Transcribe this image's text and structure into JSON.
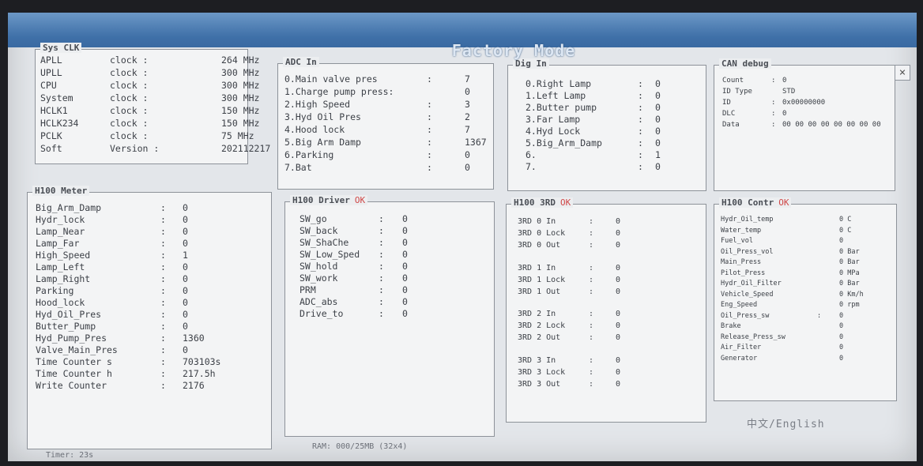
{
  "window": {
    "title": "Factory Mode",
    "close_glyph": "×"
  },
  "sys_clk": {
    "title": "Sys CLK",
    "rows": [
      {
        "name": "APLL",
        "sep": "clock :",
        "value": "264 MHz"
      },
      {
        "name": "UPLL",
        "sep": "clock :",
        "value": "300 MHz"
      },
      {
        "name": "CPU",
        "sep": "clock :",
        "value": "300 MHz"
      },
      {
        "name": "System",
        "sep": "clock :",
        "value": "300 MHz"
      },
      {
        "name": "HCLK1",
        "sep": "clock :",
        "value": "150 MHz"
      },
      {
        "name": "HCLK234",
        "sep": "clock :",
        "value": "150 MHz"
      },
      {
        "name": "PCLK",
        "sep": "clock :",
        "value": "75 MHz"
      },
      {
        "name": "Soft",
        "sep": "Version :",
        "value": "202112217"
      }
    ]
  },
  "adc_in": {
    "title": "ADC In",
    "rows": [
      {
        "name": "0.Main valve pres",
        "sep": ":",
        "value": "7"
      },
      {
        "name": "1.Charge pump press:",
        "sep": "",
        "value": "0"
      },
      {
        "name": "2.High Speed",
        "sep": ":",
        "value": "3"
      },
      {
        "name": "3.Hyd Oil Pres",
        "sep": ":",
        "value": "2"
      },
      {
        "name": "4.Hood lock",
        "sep": ":",
        "value": "7"
      },
      {
        "name": "5.Big Arm Damp",
        "sep": ":",
        "value": "1367"
      },
      {
        "name": "6.Parking",
        "sep": ":",
        "value": "0"
      },
      {
        "name": "7.Bat",
        "sep": ":",
        "value": "0"
      }
    ]
  },
  "dig_in": {
    "title": "Dig In",
    "rows": [
      {
        "name": "0.Right Lamp",
        "sep": ":",
        "value": "0"
      },
      {
        "name": "1.Left Lamp",
        "sep": ":",
        "value": "0"
      },
      {
        "name": "2.Butter pump",
        "sep": ":",
        "value": "0"
      },
      {
        "name": "3.Far Lamp",
        "sep": ":",
        "value": "0"
      },
      {
        "name": "4.Hyd Lock",
        "sep": ":",
        "value": "0"
      },
      {
        "name": "5.Big_Arm_Damp",
        "sep": ":",
        "value": "0"
      },
      {
        "name": "6.",
        "sep": ":",
        "value": "1"
      },
      {
        "name": "7.",
        "sep": ":",
        "value": "0"
      }
    ]
  },
  "can_debug": {
    "title": "CAN debug",
    "rows": [
      {
        "name": "Count",
        "sep": ":",
        "value": "0"
      },
      {
        "name": "ID Type",
        "sep": "",
        "value": "STD"
      },
      {
        "name": "ID",
        "sep": ":",
        "value": "0x00000000"
      },
      {
        "name": "DLC",
        "sep": ":",
        "value": "0"
      },
      {
        "name": "Data",
        "sep": ":",
        "value": "00 00 00 00 00 00 00 00"
      }
    ]
  },
  "meter": {
    "title": "H100 Meter",
    "rows": [
      {
        "name": "Big_Arm_Damp",
        "sep": ":",
        "value": "0"
      },
      {
        "name": "Hydr_lock",
        "sep": ":",
        "value": "0"
      },
      {
        "name": "Lamp_Near",
        "sep": ":",
        "value": "0"
      },
      {
        "name": "Lamp_Far",
        "sep": ":",
        "value": "0"
      },
      {
        "name": "High_Speed",
        "sep": ":",
        "value": "1"
      },
      {
        "name": "Lamp_Left",
        "sep": ":",
        "value": "0"
      },
      {
        "name": "Lamp_Right",
        "sep": ":",
        "value": "0"
      },
      {
        "name": "Parking",
        "sep": ":",
        "value": "0"
      },
      {
        "name": "Hood_lock",
        "sep": ":",
        "value": "0"
      },
      {
        "name": "Hyd_Oil_Pres",
        "sep": ":",
        "value": "0"
      },
      {
        "name": "Butter_Pump",
        "sep": ":",
        "value": "0"
      },
      {
        "name": "Hyd_Pump_Pres",
        "sep": ":",
        "value": "1360"
      },
      {
        "name": "Valve_Main_Pres",
        "sep": ":",
        "value": "0"
      },
      {
        "name": "Time Counter s",
        "sep": ":",
        "value": "703103s"
      },
      {
        "name": "Time Counter h",
        "sep": ":",
        "value": "217.5h"
      },
      {
        "name": "Write Counter",
        "sep": ":",
        "value": "2176"
      }
    ]
  },
  "driver": {
    "title": "H100 Driver",
    "mark": "OK",
    "rows": [
      {
        "name": "SW_go",
        "sep": ":",
        "value": "0"
      },
      {
        "name": "SW_back",
        "sep": ":",
        "value": "0"
      },
      {
        "name": "SW_ShaChe",
        "sep": ":",
        "value": "0"
      },
      {
        "name": "SW_Low_Sped",
        "sep": ":",
        "value": "0"
      },
      {
        "name": "SW_hold",
        "sep": ":",
        "value": "0"
      },
      {
        "name": "SW_work",
        "sep": ":",
        "value": "0"
      },
      {
        "name": "PRM",
        "sep": ":",
        "value": "0"
      },
      {
        "name": "ADC_abs",
        "sep": ":",
        "value": "0"
      },
      {
        "name": "Drive_to",
        "sep": ":",
        "value": "0"
      }
    ]
  },
  "three_rd": {
    "title": "H100 3RD",
    "mark": "OK",
    "rows": [
      {
        "name": "3RD 0 In",
        "sep": ":",
        "value": "0"
      },
      {
        "name": "3RD 0 Lock",
        "sep": ":",
        "value": "0"
      },
      {
        "name": "3RD 0 Out",
        "sep": ":",
        "value": "0"
      },
      {
        "name": "3RD 1 In",
        "sep": ":",
        "value": "0"
      },
      {
        "name": "3RD 1 Lock",
        "sep": ":",
        "value": "0"
      },
      {
        "name": "3RD 1 Out",
        "sep": ":",
        "value": "0"
      },
      {
        "name": "3RD 2 In",
        "sep": ":",
        "value": "0"
      },
      {
        "name": "3RD 2 Lock",
        "sep": ":",
        "value": "0"
      },
      {
        "name": "3RD 2 Out",
        "sep": ":",
        "value": "0"
      },
      {
        "name": "3RD 3 In",
        "sep": ":",
        "value": "0"
      },
      {
        "name": "3RD 3 Lock",
        "sep": ":",
        "value": "0"
      },
      {
        "name": "3RD 3 Out",
        "sep": ":",
        "value": "0"
      }
    ]
  },
  "contr": {
    "title": "H100 Contr",
    "mark": "OK",
    "rows": [
      {
        "name": "Hydr_Oil_temp",
        "sep": "",
        "value": "0 C"
      },
      {
        "name": "Water_temp",
        "sep": "",
        "value": "0 C"
      },
      {
        "name": "Fuel_vol",
        "sep": "",
        "value": "0"
      },
      {
        "name": "Oil_Press_vol",
        "sep": "",
        "value": "0 Bar"
      },
      {
        "name": "Main_Press",
        "sep": "",
        "value": "0 Bar"
      },
      {
        "name": "Pilot_Press",
        "sep": "",
        "value": "0 MPa"
      },
      {
        "name": "Hydr_Oil_Filter",
        "sep": "",
        "value": "0 Bar"
      },
      {
        "name": "Vehicle_Speed",
        "sep": "",
        "value": "0 Km/h"
      },
      {
        "name": "Eng_Speed",
        "sep": "",
        "value": "0 rpm"
      },
      {
        "name": "Oil_Press_sw",
        "sep": ":",
        "value": "0"
      },
      {
        "name": "Brake",
        "sep": "",
        "value": "0"
      },
      {
        "name": "Release_Press_sw",
        "sep": "",
        "value": "0"
      },
      {
        "name": "Air_Filter",
        "sep": "",
        "value": "0"
      },
      {
        "name": "Generator",
        "sep": "",
        "value": "0"
      }
    ]
  },
  "footer": {
    "timer": "Timer: 23s",
    "ram": "RAM: 000/25MB  (32x4)",
    "language": "中文/English"
  }
}
